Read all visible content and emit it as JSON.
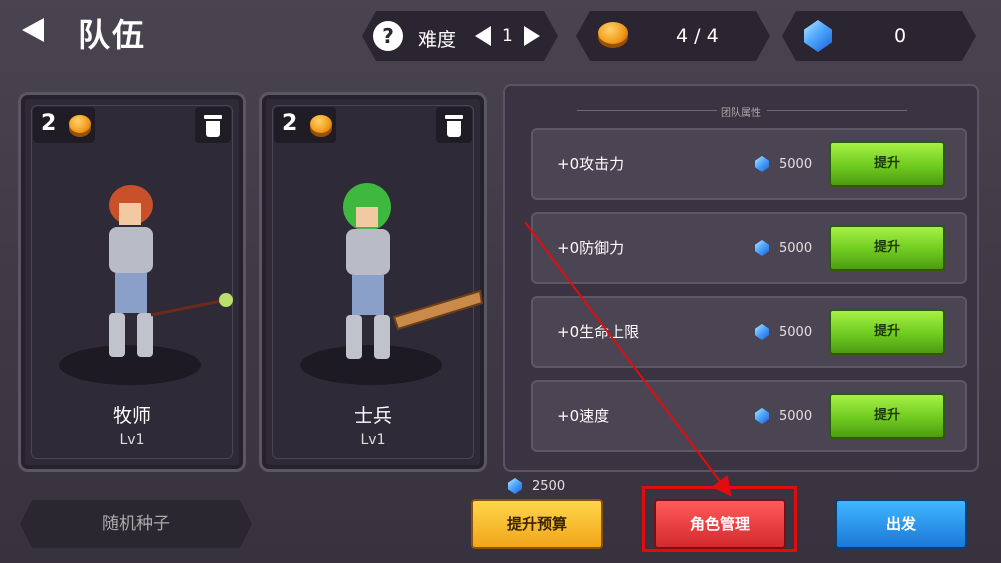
{
  "header": {
    "title": "队伍",
    "difficulty_label": "难度",
    "difficulty_value": "1",
    "coins": "4 / 4",
    "gems": "0"
  },
  "team": [
    {
      "cost": "2",
      "name": "牧师",
      "level": "Lv1"
    },
    {
      "cost": "2",
      "name": "士兵",
      "level": "Lv1"
    }
  ],
  "panel": {
    "title": "团队属性",
    "rows": [
      {
        "label": "+0攻击力",
        "cost": "5000",
        "button": "提升"
      },
      {
        "label": "+0防御力",
        "cost": "5000",
        "button": "提升"
      },
      {
        "label": "+0生命上限",
        "cost": "5000",
        "button": "提升"
      },
      {
        "label": "+0速度",
        "cost": "5000",
        "button": "提升"
      }
    ]
  },
  "footer": {
    "seed_label": "随机种子",
    "budget_cost": "2500",
    "budget_button": "提升预算",
    "manage_button": "角色管理",
    "go_button": "出发"
  },
  "colors": {
    "highlight": "#e10c10",
    "annotation_arrow": "#e10c10"
  }
}
